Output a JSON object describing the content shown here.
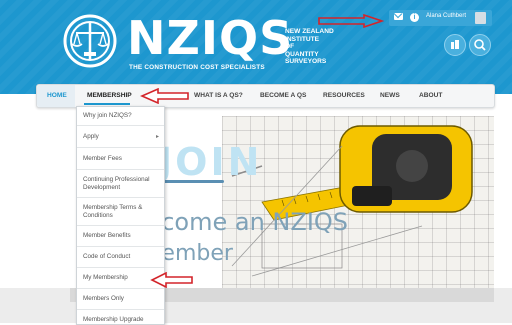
{
  "header": {
    "logo_word": "NZIQS",
    "logo_full_lines": [
      "NEW ZEALAND",
      "INSTITUTE",
      "OF",
      "QUANTITY",
      "SURVEYORS"
    ],
    "tagline": "THE CONSTRUCTION COST SPECIALISTS",
    "user_name": "Alana Cuthbert"
  },
  "nav": {
    "items": [
      "HOME",
      "MEMBERSHIP",
      "EVENTS",
      "WHAT IS A QS?",
      "BECOME A QS",
      "RESOURCES",
      "NEWS",
      "ABOUT"
    ]
  },
  "dropdown": {
    "items": [
      {
        "label": "Why join NZIQS?"
      },
      {
        "label": "Apply",
        "has_submenu": true
      },
      {
        "label": "Member Fees"
      },
      {
        "label": "Continuing Professional Development"
      },
      {
        "label": "Membership Terms & Conditions"
      },
      {
        "label": "Member Benefits"
      },
      {
        "label": "Code of Conduct"
      },
      {
        "label": "My Membership"
      },
      {
        "label": "Members Only"
      },
      {
        "label": "Membership Upgrade"
      }
    ]
  },
  "hero": {
    "line1": "JOIN",
    "line2": "Become an NZIQS",
    "line3": "member"
  },
  "colors": {
    "brand_blue": "#1d97cf",
    "annotation_red": "#d3242a",
    "tape_yellow": "#f5c400"
  }
}
